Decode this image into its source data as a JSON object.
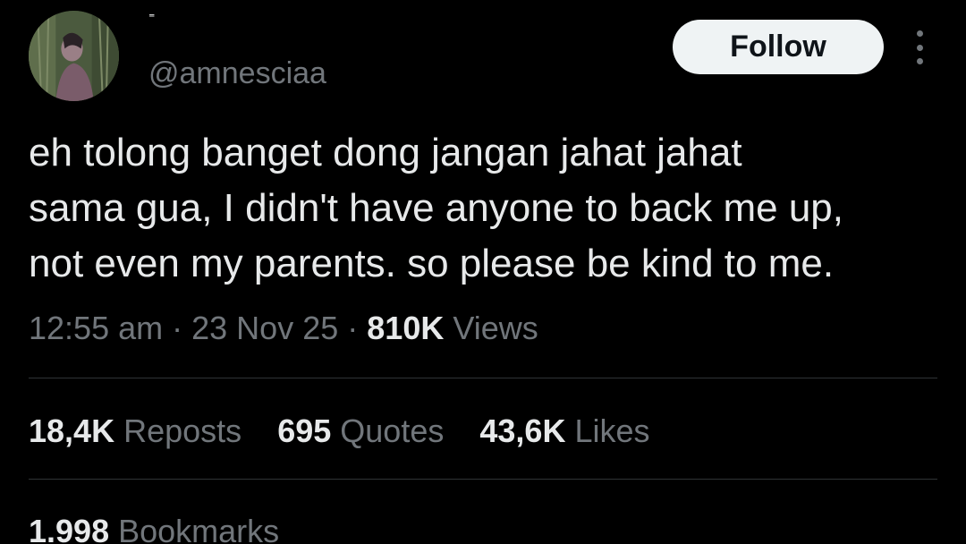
{
  "author": {
    "display_name": "⁼",
    "handle": "@amnesciaa",
    "avatar_icon": "user-avatar-photo"
  },
  "actions": {
    "follow_label": "Follow",
    "more_icon": "more-vertical-icon"
  },
  "tweet": {
    "lines": [
      "eh tolong banget dong jangan jahat jahat",
      "sama gua, I didn't have anyone to back me up,",
      "not even my parents. so please be kind to me."
    ],
    "time": "12:55 am",
    "date": "23 Nov 25",
    "separator": "·",
    "views_count": "810K",
    "views_label": "Views"
  },
  "stats": {
    "reposts_count": "18,4K",
    "reposts_label": "Reposts",
    "quotes_count": "695",
    "quotes_label": "Quotes",
    "likes_count": "43,6K",
    "likes_label": "Likes",
    "bookmarks_count": "1.998",
    "bookmarks_label": "Bookmarks"
  },
  "colors": {
    "background": "#000000",
    "primary_text": "#e7e9ea",
    "secondary_text": "#71767b",
    "divider": "#2f3336",
    "follow_bg": "#eff3f4"
  }
}
